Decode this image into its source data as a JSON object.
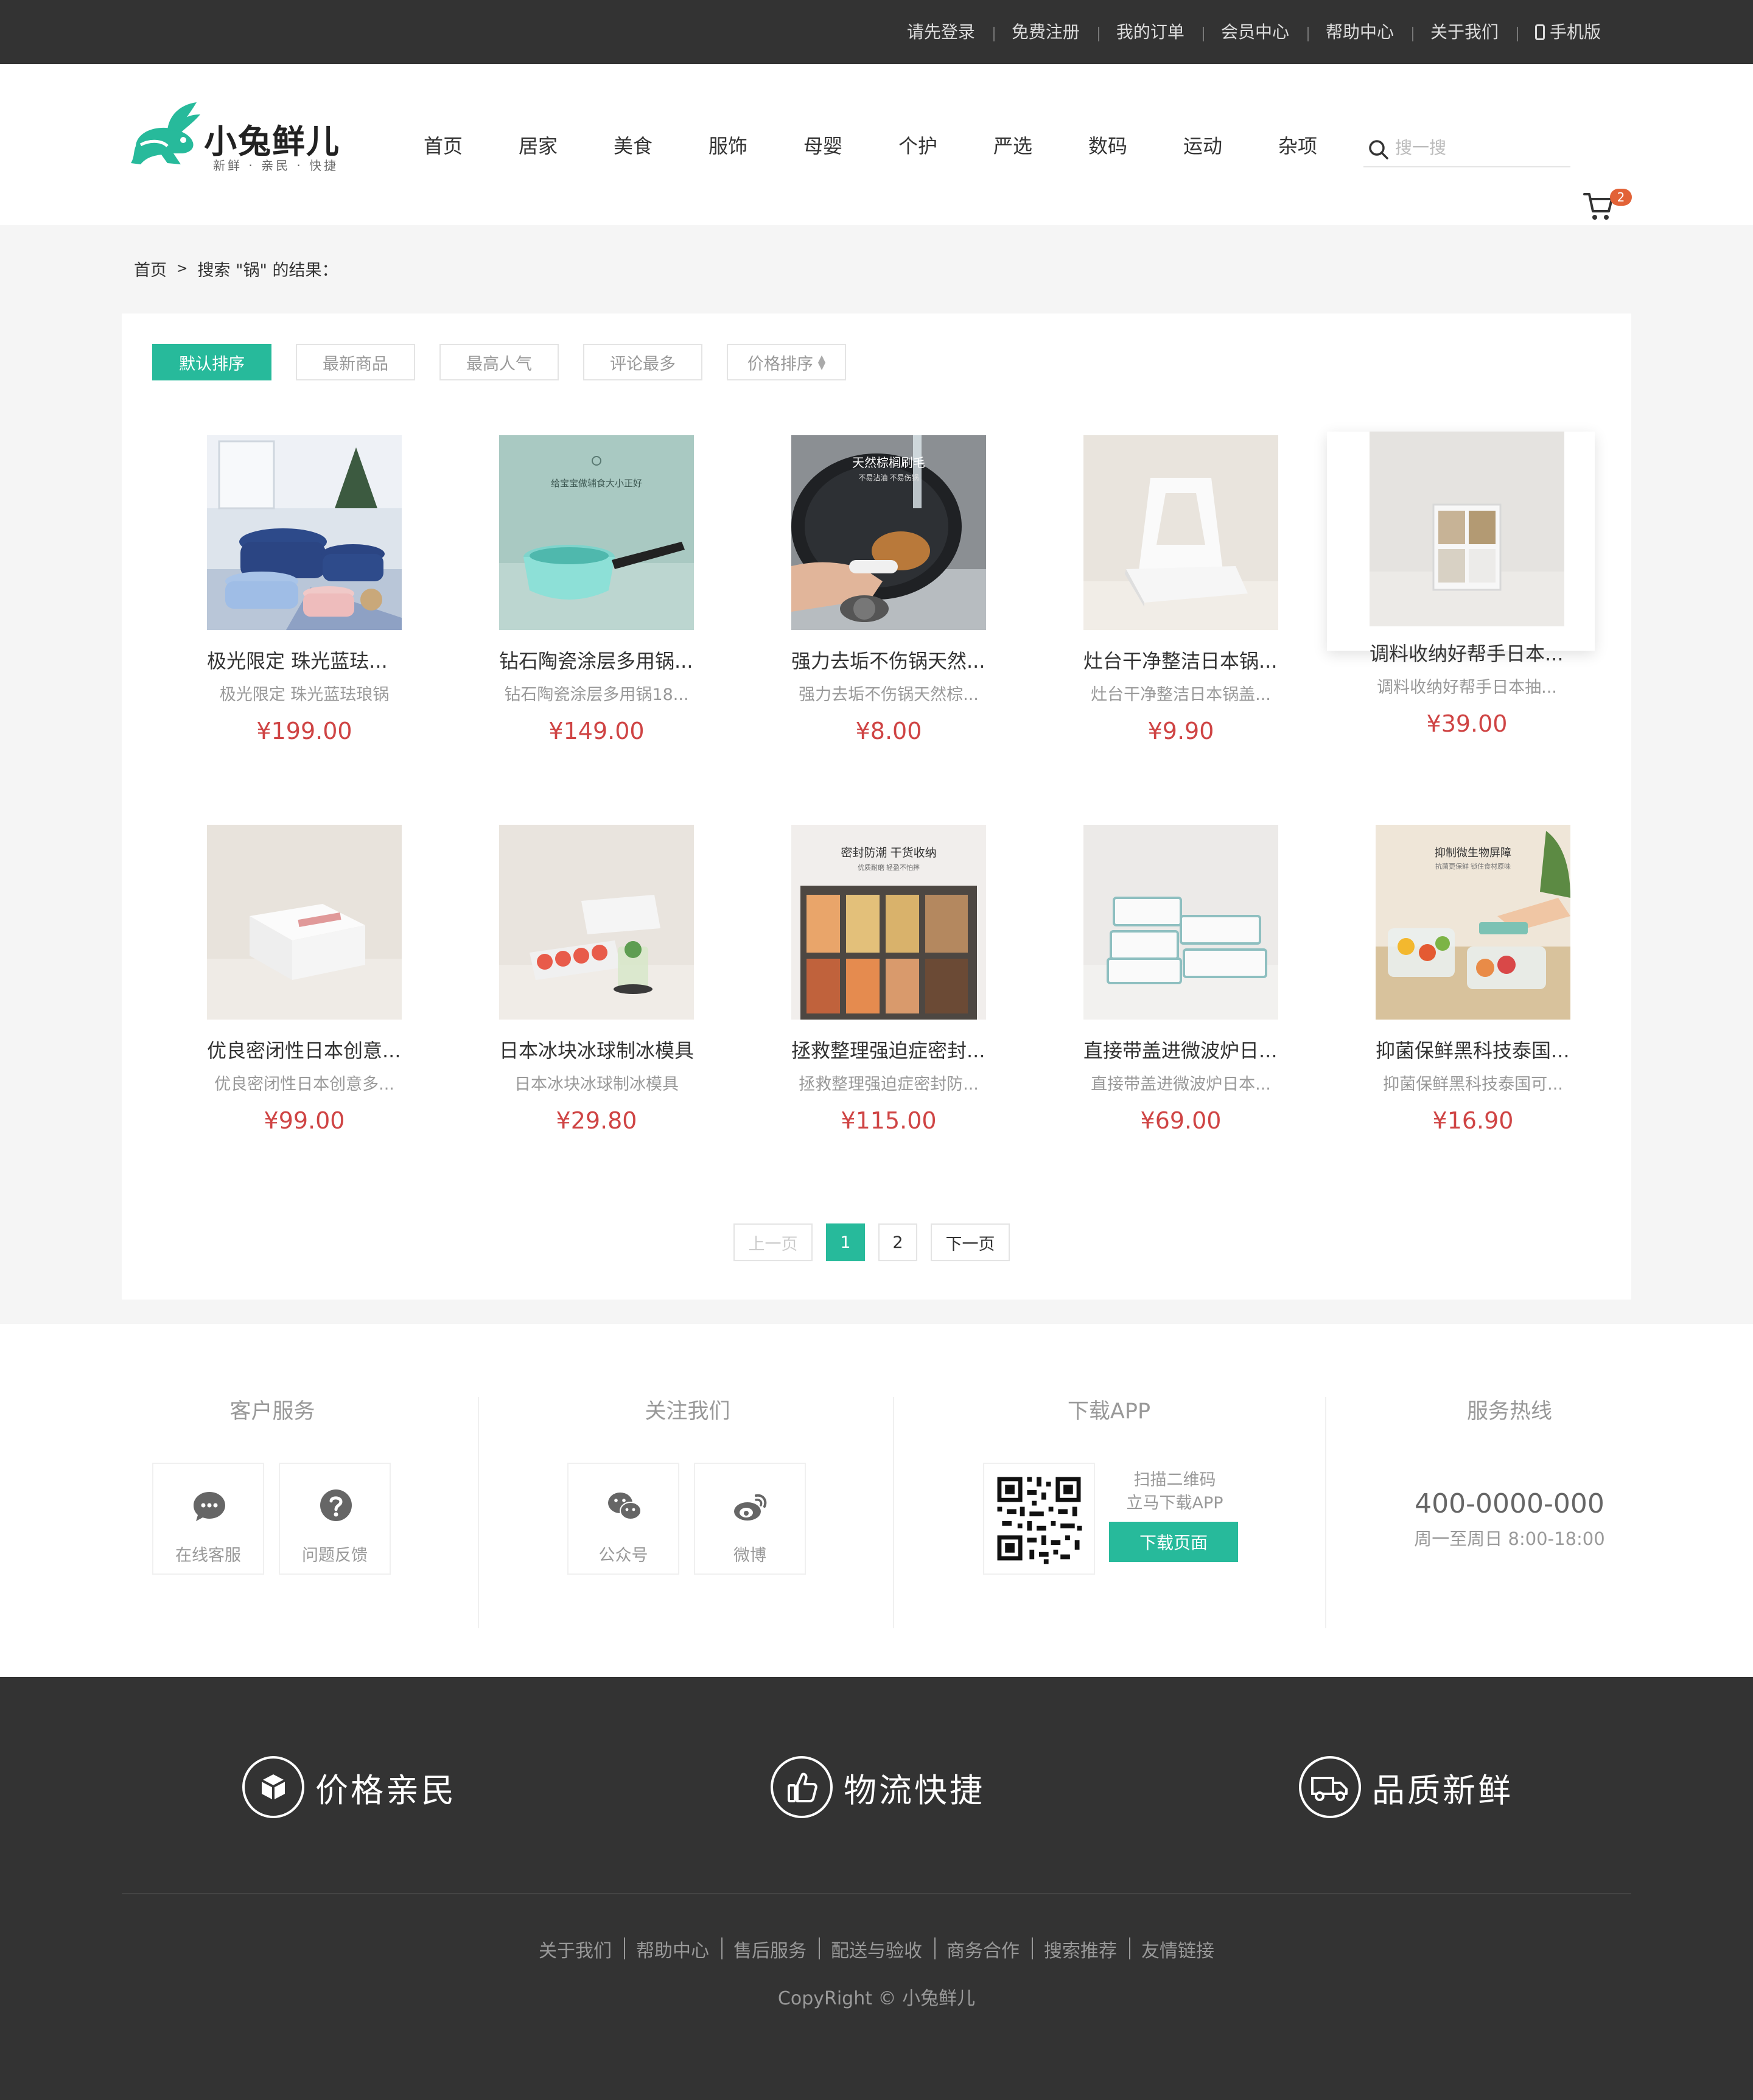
{
  "topbar": {
    "links": [
      "请先登录",
      "免费注册",
      "我的订单",
      "会员中心",
      "帮助中心",
      "关于我们",
      "手机版"
    ]
  },
  "header": {
    "logo_title": "小兔鲜儿",
    "logo_slogan": "新鲜 · 亲民 · 快捷",
    "nav": [
      "首页",
      "居家",
      "美食",
      "服饰",
      "母婴",
      "个护",
      "严选",
      "数码",
      "运动",
      "杂项"
    ],
    "search_placeholder": "搜一搜",
    "cart_count": "2",
    "brand_color": "#27ba9b",
    "badge_color": "#e26237"
  },
  "breadcrumb": {
    "home": "首页",
    "current": "搜索 \"锅\" 的结果："
  },
  "sort": [
    "默认排序",
    "最新商品",
    "最高人气",
    "评论最多",
    "价格排序"
  ],
  "goods": [
    {
      "name": "极光限定 珠光蓝珐...",
      "desc": "极光限定 珠光蓝珐琅锅",
      "price": "¥199.00"
    },
    {
      "name": "钻石陶瓷涂层多用锅...",
      "desc": "钻石陶瓷涂层多用锅18...",
      "price": "¥149.00"
    },
    {
      "name": "强力去垢不伤锅天然...",
      "desc": "强力去垢不伤锅天然棕...",
      "price": "¥8.00"
    },
    {
      "name": "灶台干净整洁日本锅...",
      "desc": "灶台干净整洁日本锅盖...",
      "price": "¥9.90"
    },
    {
      "name": "调料收纳好帮手日本...",
      "desc": "调料收纳好帮手日本抽...",
      "price": "¥39.00"
    },
    {
      "name": "优良密闭性日本创意...",
      "desc": "优良密闭性日本创意多...",
      "price": "¥99.00"
    },
    {
      "name": "日本冰块冰球制冰模具",
      "desc": "日本冰块冰球制冰模具",
      "price": "¥29.80"
    },
    {
      "name": "拯救整理强迫症密封...",
      "desc": "拯救整理强迫症密封防...",
      "price": "¥115.00"
    },
    {
      "name": "直接带盖进微波炉日...",
      "desc": "直接带盖进微波炉日本...",
      "price": "¥69.00"
    },
    {
      "name": "抑菌保鲜黑科技泰国...",
      "desc": "抑菌保鲜黑科技泰国可...",
      "price": "¥16.90"
    }
  ],
  "image_captions": {
    "g2": "给宝宝做辅食大小正好",
    "g3_title": "天然棕榈刷毛",
    "g3_sub": "不易沾油 不易伤锅",
    "g8_title": "密封防潮 干货收纳",
    "g8_sub": "优质耐磨 轻盈不怕摔",
    "g10_title": "抑制微生物屏障",
    "g10_sub": "抗菌更保鲜 锁住食材原味"
  },
  "pagination": {
    "prev": "上一页",
    "pages": [
      "1",
      "2"
    ],
    "next": "下一页",
    "current": "1"
  },
  "contact": {
    "service_title": "客户服务",
    "service_items": [
      "在线客服",
      "问题反馈"
    ],
    "follow_title": "关注我们",
    "follow_items": [
      "公众号",
      "微博"
    ],
    "app_title": "下载APP",
    "app_text_1": "扫描二维码",
    "app_text_2": "立马下载APP",
    "app_button": "下载页面",
    "hotline_title": "服务热线",
    "hotline": "400-0000-000",
    "hours": "周一至周日 8:00-18:00"
  },
  "promises": [
    "价格亲民",
    "物流快捷",
    "品质新鲜"
  ],
  "footer_links": [
    "关于我们",
    "帮助中心",
    "售后服务",
    "配送与验收",
    "商务合作",
    "搜索推荐",
    "友情链接"
  ],
  "copyright": "CopyRight © 小兔鲜儿"
}
